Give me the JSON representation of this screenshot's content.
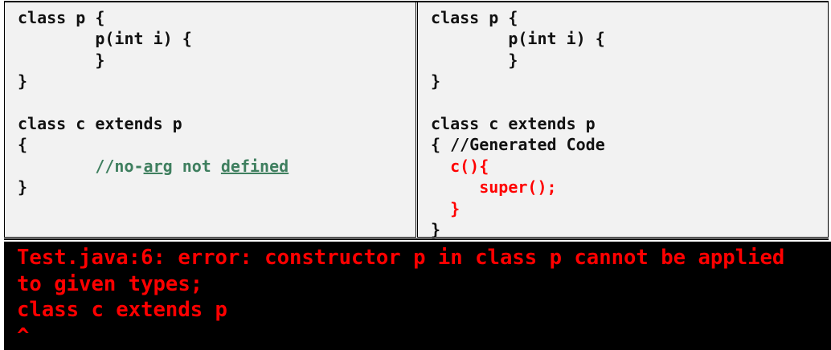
{
  "left_code": [
    [
      {
        "t": "class p {"
      }
    ],
    [
      {
        "t": "        p(int i) {"
      }
    ],
    [
      {
        "t": "        }"
      }
    ],
    [
      {
        "t": "}"
      }
    ],
    [
      {
        "t": ""
      }
    ],
    [
      {
        "t": "class c extends p"
      }
    ],
    [
      {
        "t": "{"
      }
    ],
    [
      {
        "t": "        "
      },
      {
        "t": "//no-",
        "c": "comment"
      },
      {
        "t": "arg",
        "c": "comment u"
      },
      {
        "t": " not ",
        "c": "comment"
      },
      {
        "t": "defined",
        "c": "comment u"
      }
    ],
    [
      {
        "t": "}"
      }
    ]
  ],
  "right_code": [
    [
      {
        "t": "class p {"
      }
    ],
    [
      {
        "t": "        p(int i) {"
      }
    ],
    [
      {
        "t": "        }"
      }
    ],
    [
      {
        "t": "}"
      }
    ],
    [
      {
        "t": ""
      }
    ],
    [
      {
        "t": "class c extends p"
      }
    ],
    [
      {
        "t": "{ //Generated Code"
      }
    ],
    [
      {
        "t": "  "
      },
      {
        "t": "c(){",
        "c": "gen"
      }
    ],
    [
      {
        "t": "     "
      },
      {
        "t": "super();",
        "c": "gen"
      }
    ],
    [
      {
        "t": "  "
      },
      {
        "t": "}",
        "c": "gen"
      }
    ],
    [
      {
        "t": "}"
      }
    ]
  ],
  "console": {
    "lines": [
      "Test.java:6: error: constructor p in class p cannot be applied",
      "to given types;",
      "class c extends p",
      "^"
    ]
  },
  "colors": {
    "comment": "#3f7f5f",
    "generated": "#ff0000",
    "error": "#ff0000",
    "panel_bg": "#f2f2f2",
    "console_bg": "#000000"
  }
}
